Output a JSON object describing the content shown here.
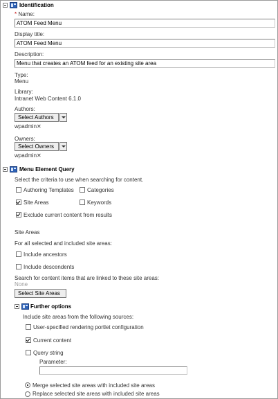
{
  "identification": {
    "title": "Identification",
    "name_label": "Name:",
    "name_required_marker": "*",
    "name_value": "ATOM Feed Menu",
    "display_title_label": "Display title:",
    "display_title_value": "ATOM Feed Menu",
    "description_label": "Description:",
    "description_value": "Menu that creates an ATOM feed for an existing site area",
    "type_label": "Type:",
    "type_value": "Menu",
    "library_label": "Library:",
    "library_value": "Intranet Web Content 6.1.0",
    "authors_label": "Authors:",
    "select_authors_label": "Select Authors",
    "author_value": "wpadmin",
    "owners_label": "Owners:",
    "select_owners_label": "Select Owners",
    "owner_value": "wpadmin",
    "remove_symbol": "✕"
  },
  "menu_query": {
    "title": "Menu Element Query",
    "instruction": "Select the criteria to use when searching for content.",
    "criteria": [
      {
        "label": "Authoring Templates",
        "checked": false
      },
      {
        "label": "Categories",
        "checked": false
      },
      {
        "label": "Site Areas",
        "checked": true
      },
      {
        "label": "Keywords",
        "checked": false
      }
    ],
    "exclude_label": "Exclude current content from results",
    "exclude_checked": true,
    "site_areas_heading": "Site Areas",
    "site_areas_instruction": "For all selected and included site areas:",
    "include_ancestors_label": "Include ancestors",
    "include_descendents_label": "Include descendents",
    "linked_label": "Search for content items that are linked to these site areas:",
    "linked_value": "None",
    "select_site_areas_label": "Select Site Areas"
  },
  "further_options": {
    "title": "Further options",
    "instruction": "Include site areas from the following sources:",
    "options": [
      {
        "label": "User-specified rendering portlet configuration",
        "checked": false
      },
      {
        "label": "Current content",
        "checked": true
      },
      {
        "label": "Query string",
        "checked": false
      }
    ],
    "parameter_label": "Parameter:",
    "parameter_value": "",
    "merge_label": "Merge selected site areas with included site areas",
    "replace_label": "Replace selected site areas with included site areas",
    "selected_radio": "merge"
  }
}
